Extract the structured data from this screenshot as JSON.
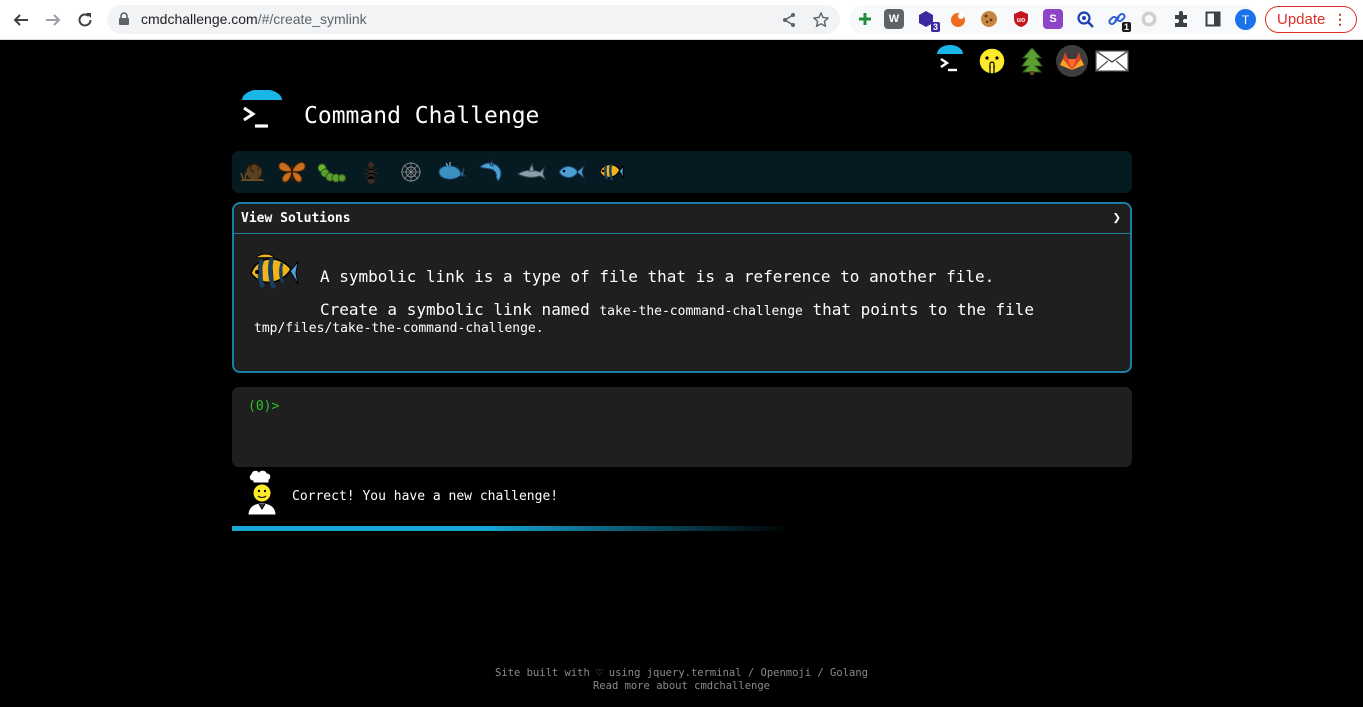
{
  "browser": {
    "url_host": "cmdchallenge.com",
    "url_path": "/#/create_symlink",
    "extensions": [
      {
        "icon": "plus-extension-icon",
        "color": "#ffffff"
      },
      {
        "icon": "w-extension-icon",
        "label": "W",
        "color": "#555555"
      },
      {
        "icon": "hexagon-extension-icon",
        "badge": "3",
        "color": "#3a2a9e"
      },
      {
        "icon": "flame-extension-icon",
        "color": "#f26b21"
      },
      {
        "icon": "cookie-extension-icon",
        "color": "#8b5a2b"
      },
      {
        "icon": "ublock-icon",
        "label": "uo",
        "color": "#c4161c"
      },
      {
        "icon": "s-extension-icon",
        "label": "S",
        "color": "#8e44c9"
      },
      {
        "icon": "magnifier-extension-icon",
        "color": "#1a3fb5"
      },
      {
        "icon": "link-extension-icon",
        "badge": "1",
        "color": "#2b5fd6"
      },
      {
        "icon": "grey-circle-extension-icon",
        "color": "#cfcfcf"
      }
    ],
    "profile_initial": "T",
    "update_label": "Update"
  },
  "site": {
    "title": "Command Challenge"
  },
  "top_links": [
    "terminal-link-icon",
    "shushing-face-icon",
    "tree-icon",
    "gitlab-icon",
    "envelope-icon"
  ],
  "challenge_levels": [
    "snail-icon",
    "butterfly-icon",
    "caterpillar-icon",
    "ant-icon",
    "web-icon",
    "whale-icon",
    "dolphin-icon",
    "shark-icon",
    "fish-icon",
    "tropical-fish-icon"
  ],
  "panel": {
    "header": "View Solutions",
    "chevron": "❯",
    "line1": "A symbolic link is a type of file that is a reference to another file.",
    "line2_pre": "Create a symbolic link named ",
    "line2_code": "take-the-command-challenge",
    "line2_post": " that points to the file",
    "line3": "tmp/files/take-the-command-challenge."
  },
  "terminal": {
    "prompt": "(0)>"
  },
  "status": {
    "message": "Correct! You have a new challenge!",
    "progress_fraction": 0.45
  },
  "footer": {
    "line1": "Site built with ♡ using jquery.terminal / Openmoji / Golang",
    "line2": "Read more about cmdchallenge"
  }
}
